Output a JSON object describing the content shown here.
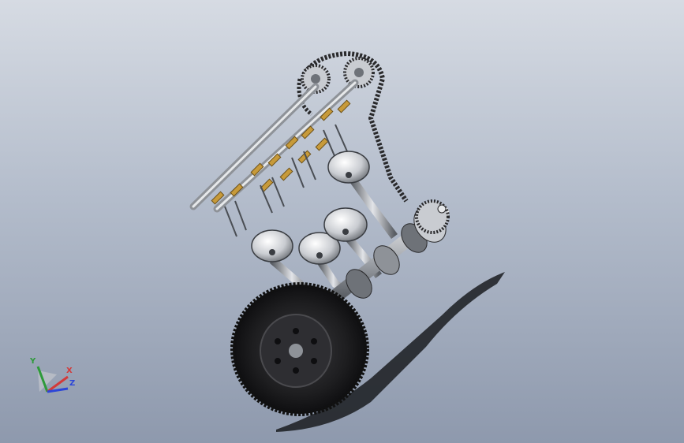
{
  "viewport": {
    "background_top": "#d6dbe3",
    "background_bottom": "#8e99ad"
  },
  "model": {
    "name": "engine-assembly",
    "components": [
      "camshaft",
      "camshaft",
      "timing-chain",
      "cam-sprocket",
      "crank-sprocket",
      "valve",
      "rocker-arm",
      "piston",
      "connecting-rod",
      "crankshaft",
      "flywheel"
    ],
    "accent_color": "#c79a3a",
    "metal_color": "#b8bcc2",
    "dark_color": "#2a2a2c"
  },
  "triad": {
    "x_label": "X",
    "y_label": "Y",
    "z_label": "Z",
    "x_color": "#d23a3a",
    "y_color": "#2e9a3a",
    "z_color": "#2c46d8"
  }
}
